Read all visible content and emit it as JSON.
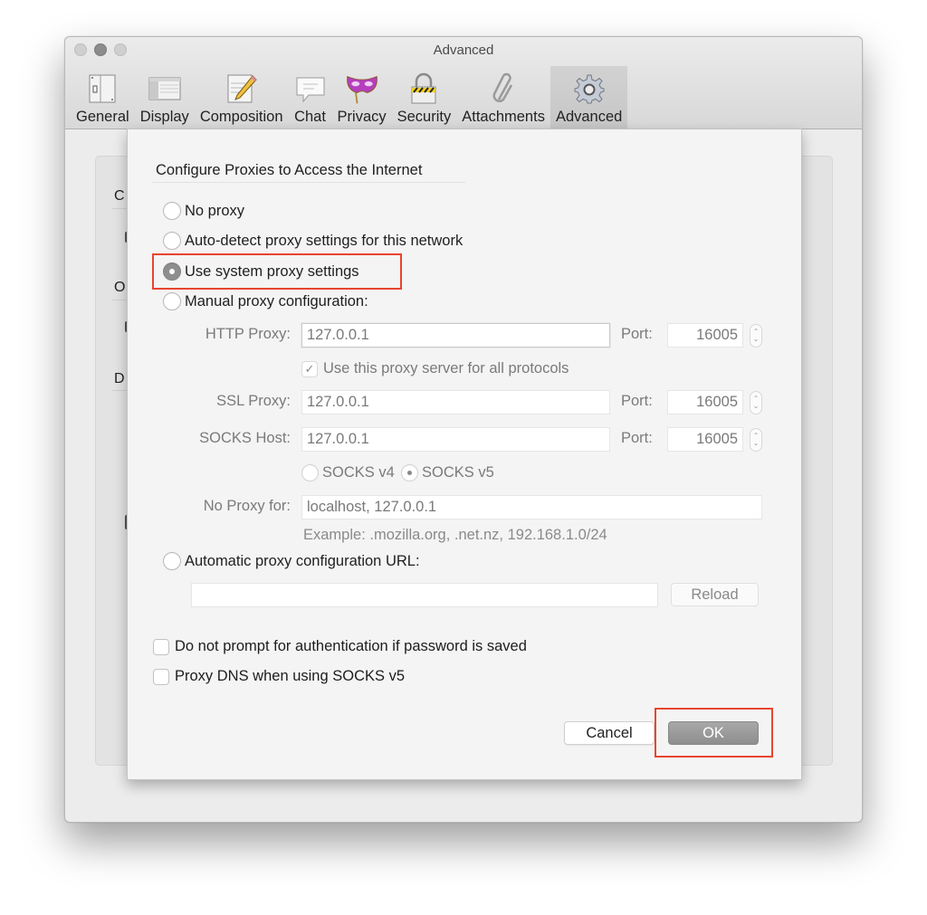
{
  "window": {
    "title": "Advanced",
    "toolbar": [
      {
        "label": "General",
        "icon": "general-switch-icon",
        "active": false
      },
      {
        "label": "Display",
        "icon": "display-window-icon",
        "active": false
      },
      {
        "label": "Composition",
        "icon": "composition-pencil-icon",
        "active": false
      },
      {
        "label": "Chat",
        "icon": "chat-bubble-icon",
        "active": false
      },
      {
        "label": "Privacy",
        "icon": "privacy-mask-icon",
        "active": false
      },
      {
        "label": "Security",
        "icon": "security-padlock-icon",
        "active": false
      },
      {
        "label": "Attachments",
        "icon": "paperclip-icon",
        "active": false
      },
      {
        "label": "Advanced",
        "icon": "gear-icon",
        "active": true
      }
    ],
    "background_letters": [
      "C",
      "O",
      "D"
    ]
  },
  "dialog": {
    "group_title": "Configure Proxies to Access the Internet",
    "proxy_options": [
      {
        "label": "No proxy",
        "checked": false
      },
      {
        "label": "Auto-detect proxy settings for this network",
        "checked": false
      },
      {
        "label": "Use system proxy settings",
        "checked": true
      },
      {
        "label": "Manual proxy configuration:",
        "checked": false
      }
    ],
    "manual": {
      "http_proxy": {
        "label": "HTTP Proxy:",
        "value": "127.0.0.1",
        "port_label": "Port:",
        "port": "16005"
      },
      "use_for_all": {
        "label": "Use this proxy server for all protocols",
        "checked": true
      },
      "ssl_proxy": {
        "label": "SSL Proxy:",
        "value": "127.0.0.1",
        "port_label": "Port:",
        "port": "16005"
      },
      "socks_host": {
        "label": "SOCKS Host:",
        "value": "127.0.0.1",
        "port_label": "Port:",
        "port": "16005"
      },
      "socks_versions": [
        {
          "label": "SOCKS v4",
          "checked": false
        },
        {
          "label": "SOCKS v5",
          "checked": true
        }
      ],
      "no_proxy_for": {
        "label": "No Proxy for:",
        "value": "localhost, 127.0.0.1"
      },
      "example": "Example: .mozilla.org, .net.nz, 192.168.1.0/24"
    },
    "auto_config": {
      "label": "Automatic proxy configuration URL:",
      "checked": false,
      "value": "",
      "reload_label": "Reload"
    },
    "checkboxes": [
      {
        "label": "Do not prompt for authentication if password is saved",
        "checked": false
      },
      {
        "label": "Proxy DNS when using SOCKS v5",
        "checked": false
      }
    ],
    "buttons": {
      "cancel": "Cancel",
      "ok": "OK"
    },
    "annotation_color": "#e8452f"
  }
}
